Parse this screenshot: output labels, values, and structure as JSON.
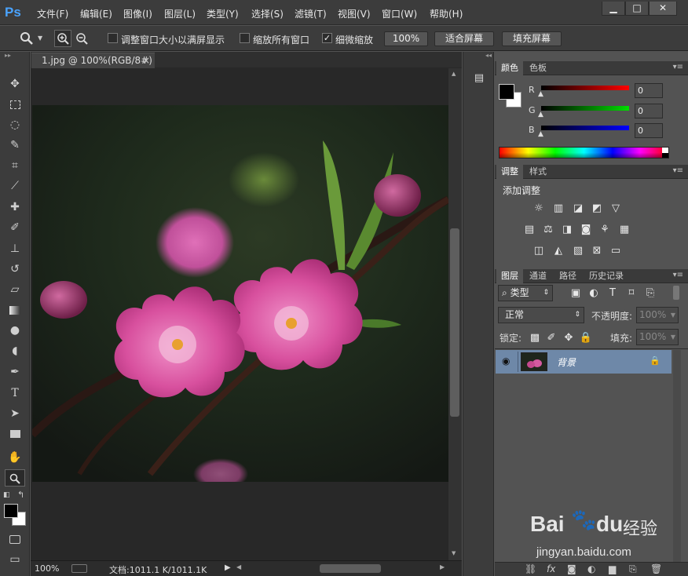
{
  "menubar": {
    "logo": "Ps",
    "items": [
      "文件(F)",
      "编辑(E)",
      "图像(I)",
      "图层(L)",
      "类型(Y)",
      "选择(S)",
      "滤镜(T)",
      "视图(V)",
      "窗口(W)",
      "帮助(H)"
    ],
    "window_buttons": [
      "▁",
      "□",
      "✕"
    ]
  },
  "options": {
    "resize_windows_label": "调整窗口大小以满屏显示",
    "resize_windows_checked": false,
    "zoom_all_label": "缩放所有窗口",
    "zoom_all_checked": false,
    "scrubby_zoom_label": "细微缩放",
    "scrubby_zoom_checked": true,
    "btn_100": "100%",
    "btn_fit": "适合屏幕",
    "btn_fill": "填充屏幕"
  },
  "document": {
    "tab_title": "1.jpg @ 100%(RGB/8#)",
    "tab_close": "×",
    "zoom": "100%",
    "doc_info": "文档:1011.1 K/1011.1K"
  },
  "color_panel": {
    "tabs": [
      "颜色",
      "色板"
    ],
    "r_label": "R",
    "r_value": "0",
    "g_label": "G",
    "g_value": "0",
    "b_label": "B",
    "b_value": "0",
    "fg_color": "#000000",
    "bg_color": "#ffffff"
  },
  "adjust_panel": {
    "tabs": [
      "调整",
      "样式"
    ],
    "title": "添加调整"
  },
  "layers_panel": {
    "tabs": [
      "图层",
      "通道",
      "路径",
      "历史记录"
    ],
    "filter_label": "类型",
    "blend_mode": "正常",
    "opacity_label": "不透明度:",
    "opacity_value": "100%",
    "lock_label": "锁定:",
    "fill_label": "填充:",
    "fill_value": "100%",
    "layer_name": "背景"
  },
  "watermark": {
    "brand": "Bai",
    "brand2": "du",
    "jy": "经验",
    "url": "jingyan.baidu.com"
  }
}
